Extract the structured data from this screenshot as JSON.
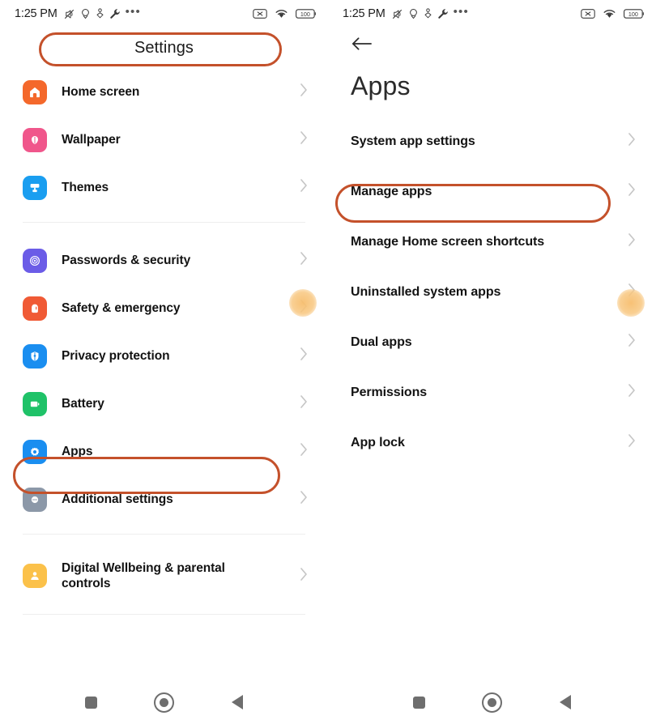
{
  "annotation": {
    "stroke_color": "#c4512b",
    "touch_indicator_color": "#f7be6e"
  },
  "statusbar": {
    "time": "1:25 PM",
    "left_icons": [
      "mute-vibrate-icon",
      "location-icon",
      "bluetooth-audio-icon",
      "wrench-icon",
      "more-dots-icon"
    ],
    "right_icons": [
      "silent-mode-icon",
      "wifi-icon",
      "battery-icon"
    ],
    "battery_level": "100"
  },
  "left_screen": {
    "title": "Settings",
    "groups": [
      {
        "items": [
          {
            "label": "Home screen",
            "icon": "home-screen-icon",
            "icon_color": "#f4682b",
            "chevron": "chevron-right-icon"
          },
          {
            "label": "Wallpaper",
            "icon": "wallpaper-icon",
            "icon_color": "#f0568b",
            "chevron": "chevron-right-icon"
          },
          {
            "label": "Themes",
            "icon": "themes-icon",
            "icon_color": "#1a9ef0",
            "chevron": "chevron-right-icon"
          }
        ]
      },
      {
        "items": [
          {
            "label": "Passwords & security",
            "icon": "fingerprint-icon",
            "icon_color": "#6b5ce7",
            "chevron": "chevron-right-icon"
          },
          {
            "label": "Safety & emergency",
            "icon": "sos-icon",
            "icon_color": "#f05a35",
            "chevron": "chevron-right-icon"
          },
          {
            "label": "Privacy protection",
            "icon": "shield-icon",
            "icon_color": "#1a8ef0",
            "chevron": "chevron-right-icon"
          },
          {
            "label": "Battery",
            "icon": "battery-settings-icon",
            "icon_color": "#1fc268",
            "chevron": "chevron-right-icon"
          },
          {
            "label": "Apps",
            "icon": "apps-gear-icon",
            "icon_color": "#1a8ef0",
            "chevron": "chevron-right-icon",
            "highlighted": true
          },
          {
            "label": "Additional settings",
            "icon": "additional-settings-icon",
            "icon_color": "#8c98a8",
            "chevron": "chevron-right-icon"
          }
        ]
      },
      {
        "items": [
          {
            "label": "Digital Wellbeing & parental controls",
            "icon": "person-icon",
            "icon_color": "#fbc14a",
            "chevron": "chevron-right-icon"
          }
        ]
      }
    ]
  },
  "right_screen": {
    "back_icon": "back-arrow-icon",
    "title": "Apps",
    "items": [
      {
        "label": "System app settings",
        "chevron": "chevron-right-icon"
      },
      {
        "label": "Manage apps",
        "chevron": "chevron-right-icon",
        "highlighted": true
      },
      {
        "label": "Manage Home screen shortcuts",
        "chevron": "chevron-right-icon"
      },
      {
        "label": "Uninstalled system apps",
        "chevron": "chevron-right-icon",
        "touched": true
      },
      {
        "label": "Dual apps",
        "chevron": "chevron-right-icon"
      },
      {
        "label": "Permissions",
        "chevron": "chevron-right-icon"
      },
      {
        "label": "App lock",
        "chevron": "chevron-right-icon"
      }
    ]
  },
  "navbar": {
    "buttons": [
      "recents-square-icon",
      "home-circle-icon",
      "back-triangle-icon"
    ]
  }
}
